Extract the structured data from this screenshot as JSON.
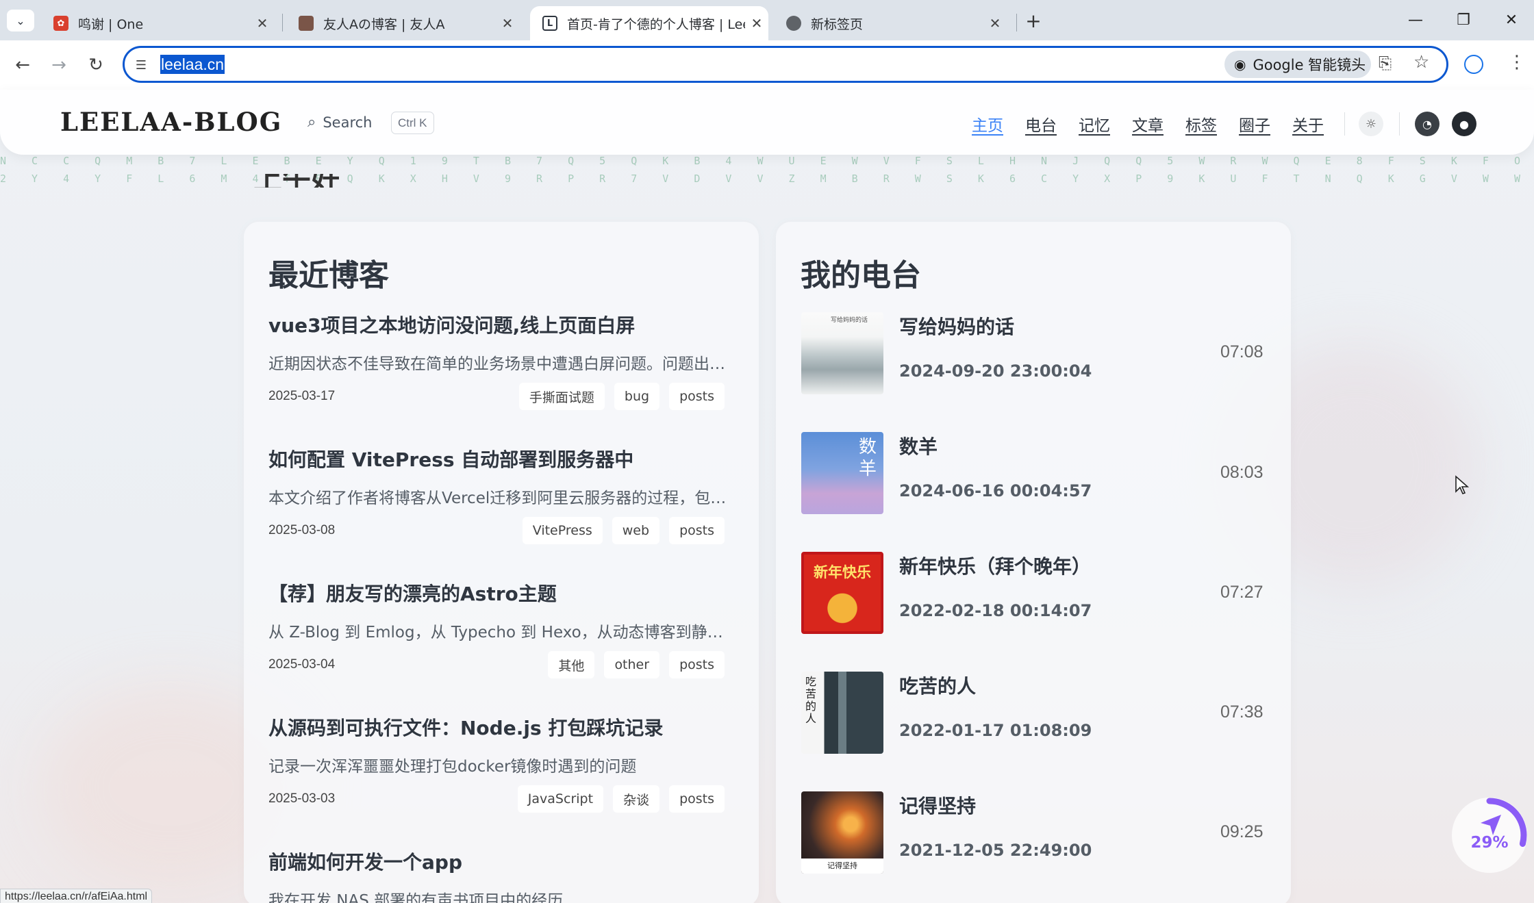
{
  "browser": {
    "tabs": [
      {
        "title": "鸣谢 | One",
        "favicon_color": "#d9402e"
      },
      {
        "title": "友人Aの博客 | 友人A",
        "favicon_color": "#7a5548"
      },
      {
        "title": "首页-肯了个德的个人博客 | Lee",
        "favicon_color": "#2f3640",
        "active": true
      },
      {
        "title": "新标签页",
        "favicon_color": "#5f6368"
      }
    ],
    "url": "leelaa.cn",
    "lens_label": "Google 智能镜头",
    "status_url": "https://leelaa.cn/r/afEiAa.html"
  },
  "site": {
    "logo": "LEELAA-BLOG",
    "search_label": "Search",
    "search_shortcut": "Ctrl K",
    "nav": [
      "主页",
      "电台",
      "记忆",
      "文章",
      "标签",
      "圈子",
      "关于"
    ],
    "hidden_heading": "上午好"
  },
  "blog": {
    "heading": "最近博客",
    "posts": [
      {
        "title": "vue3项目之本地访问没问题,线上页面白屏",
        "desc": "近期因状态不佳导致在简单的业务场景中遭遇白屏问题。问题出在...",
        "date": "2025-03-17",
        "tags": [
          "手撕面试题",
          "bug",
          "posts"
        ]
      },
      {
        "title": "如何配置 VitePress 自动部署到服务器中",
        "desc": "本文介绍了作者将博客从Vercel迁移到阿里云服务器的过程，包括...",
        "date": "2025-03-08",
        "tags": [
          "VitePress",
          "web",
          "posts"
        ]
      },
      {
        "title": "【荐】朋友写的漂亮的Astro主题",
        "desc": "从 Z-Blog 到 Emlog，从 Typecho 到 Hexo，从动态博客到静态...",
        "date": "2025-03-04",
        "tags": [
          "其他",
          "other",
          "posts"
        ]
      },
      {
        "title": "从源码到可执行文件：Node.js 打包踩坑记录",
        "desc": "记录一次浑浑噩噩处理打包docker镜像时遇到的问题",
        "date": "2025-03-03",
        "tags": [
          "JavaScript",
          "杂谈",
          "posts"
        ]
      },
      {
        "title": "前端如何开发一个app",
        "desc": "我在开发 NAS 部署的有声书项目中的经历",
        "date": "",
        "tags": []
      }
    ]
  },
  "radio": {
    "heading": "我的电台",
    "episodes": [
      {
        "title": "写给妈妈的话",
        "date": "2024-09-20 23:00:04",
        "duration": "07:08",
        "cover_text": "写给妈妈的话"
      },
      {
        "title": "数羊",
        "date": "2024-06-16 00:04:57",
        "duration": "08:03",
        "cover_text": "数羊"
      },
      {
        "title": "新年快乐（拜个晚年）",
        "date": "2022-02-18 00:14:07",
        "duration": "07:27",
        "cover_text": "新年快乐"
      },
      {
        "title": "吃苦的人",
        "date": "2022-01-17 01:08:09",
        "duration": "07:38",
        "cover_text": "吃苦的人"
      },
      {
        "title": "记得坚持",
        "date": "2021-12-05 22:49:00",
        "duration": "09:25",
        "cover_text": "记得坚持"
      }
    ]
  },
  "scroll_progress": {
    "percent": 29,
    "label": "29%"
  },
  "colors": {
    "accent": "#3b82f6",
    "progress": "#8b5cf6",
    "omnibox_border": "#0b57d0"
  }
}
